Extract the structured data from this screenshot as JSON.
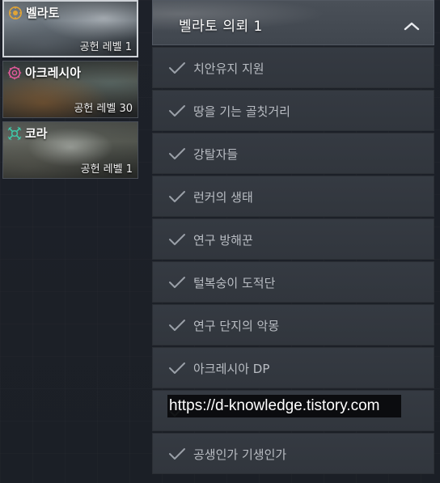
{
  "regions": [
    {
      "name": "벨라토",
      "level": "공헌 레벨 1",
      "icon": "vellato-emblem-icon",
      "accent": "#e0a437",
      "selected": true
    },
    {
      "name": "아크레시아",
      "level": "공헌 레벨 30",
      "icon": "acrasia-emblem-icon",
      "accent": "#e25a9b",
      "selected": false
    },
    {
      "name": "코라",
      "level": "공헌 레벨 1",
      "icon": "kora-emblem-icon",
      "accent": "#3fc7a8",
      "selected": false
    }
  ],
  "quest_panel": {
    "title": "벨라토 의뢰 1",
    "collapse_icon": "chevron-up-icon",
    "quests": [
      {
        "label": "치안유지 지원",
        "completed": true
      },
      {
        "label": "땅을 기는 골칫거리",
        "completed": true
      },
      {
        "label": "강탈자들",
        "completed": true
      },
      {
        "label": "런커의 생태",
        "completed": true
      },
      {
        "label": "연구 방해꾼",
        "completed": true
      },
      {
        "label": "털복숭이 도적단",
        "completed": true
      },
      {
        "label": "연구 단지의 악몽",
        "completed": true
      },
      {
        "label": "아크레시아 DP",
        "completed": true
      },
      {
        "label": "",
        "completed": true
      },
      {
        "label": "공생인가 기생인가",
        "completed": true
      }
    ]
  },
  "watermark": {
    "text": "https://d-knowledge.tistory.com"
  },
  "colors": {
    "background": "#1c2027",
    "row_background": "#353a42",
    "row_text": "#b9bdc3",
    "check": "#9aa0a8"
  }
}
